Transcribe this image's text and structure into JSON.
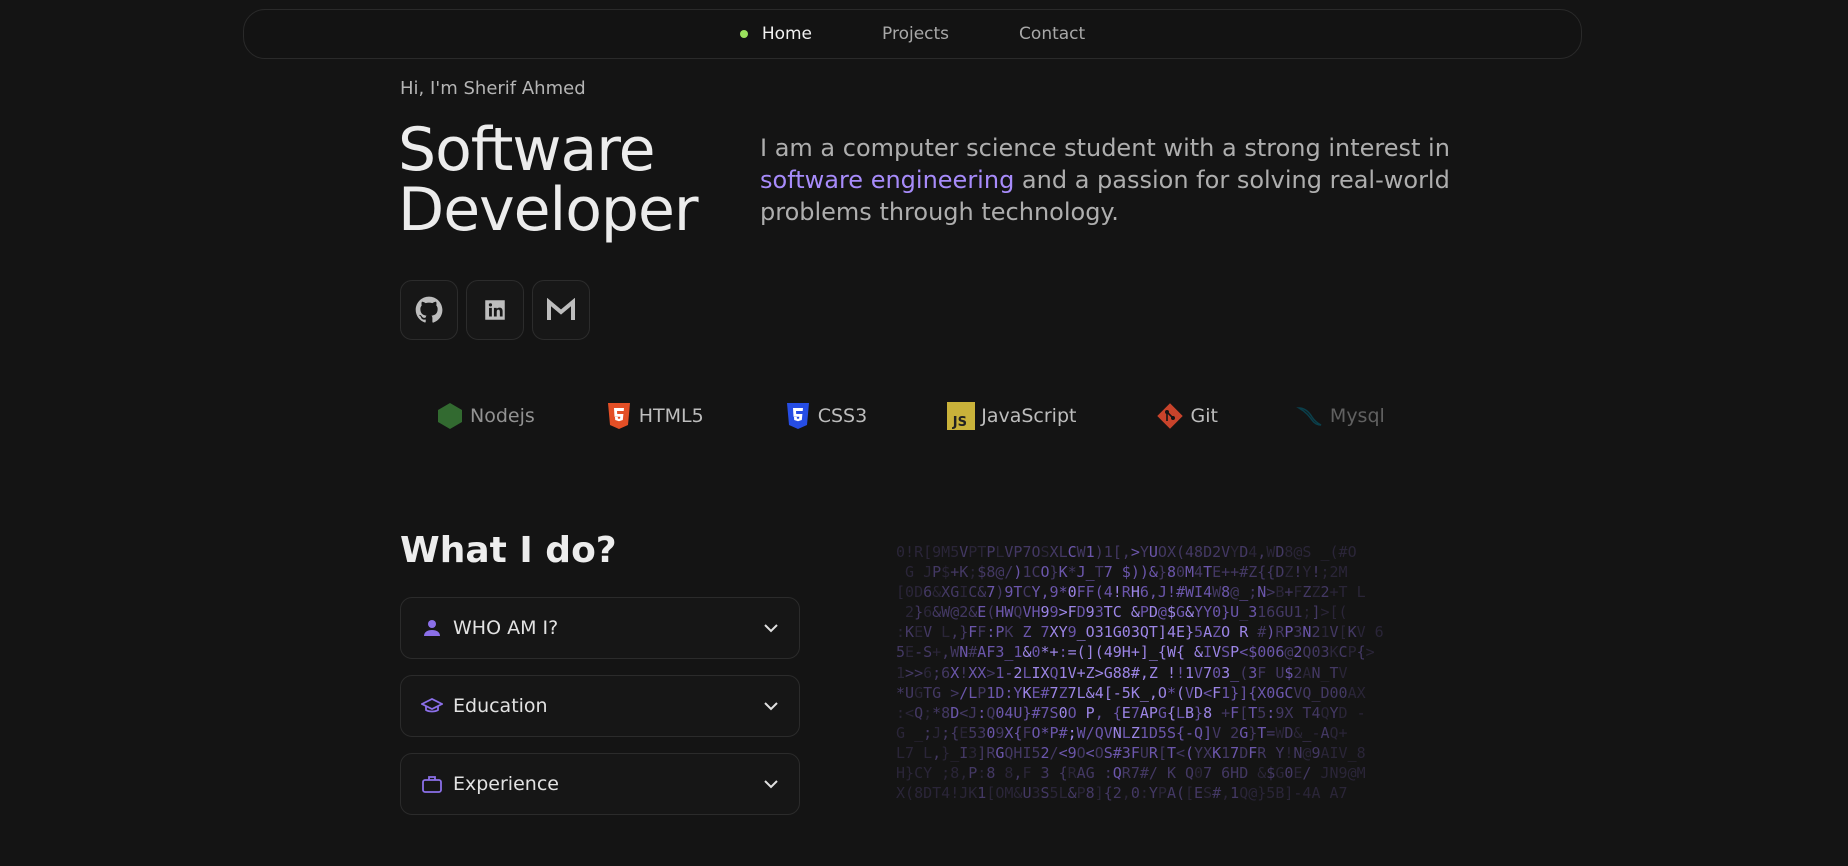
{
  "nav": {
    "items": [
      {
        "label": "Home",
        "active": true
      },
      {
        "label": "Projects",
        "active": false
      },
      {
        "label": "Contact",
        "active": false
      }
    ],
    "active_dot_color": "#9be15d"
  },
  "hero": {
    "greeting": "Hi, I'm Sherif Ahmed",
    "title_line1": "Software",
    "title_line2": "Developer",
    "bio_before": "I am a computer science student with a strong interest in ",
    "bio_highlight": "software engineering",
    "bio_after": " and a passion for solving real-world problems through technology.",
    "highlight_color": "#a78bfa"
  },
  "socials": [
    {
      "name": "github-icon"
    },
    {
      "name": "linkedin-icon"
    },
    {
      "name": "gmail-icon"
    }
  ],
  "skills": [
    {
      "label": "Nodejs",
      "icon": "nodejs-icon",
      "color": "#3c873a"
    },
    {
      "label": "HTML5",
      "icon": "html5-icon",
      "color": "#e34f26"
    },
    {
      "label": "CSS3",
      "icon": "css3-icon",
      "color": "#264de4"
    },
    {
      "label": "JavaScript",
      "icon": "javascript-icon",
      "color": "#f0db4f"
    },
    {
      "label": "Git",
      "icon": "git-icon",
      "color": "#f05032"
    },
    {
      "label": "Mysql",
      "icon": "mysql-icon",
      "color": "#00758f"
    }
  ],
  "what_i_do": {
    "title": "What I do?",
    "accordions": [
      {
        "label": "WHO AM I?",
        "icon": "user-icon"
      },
      {
        "label": "Education",
        "icon": "graduation-cap-icon"
      },
      {
        "label": "Experience",
        "icon": "briefcase-icon"
      }
    ],
    "accent_color": "#8b6fe8"
  },
  "matrix_lines": [
    "0!R[9M5VPTPLVP7OSXLCW1)1[,>YUOX(48D2VYD4,WD8@S _(#O",
    " G JP$+K;$8@/)1CO}K*J_T7 $))&}80M4TE++#Z{{DZ!Y!;2M ",
    "[0D6&XGIC&7)9TCY,9*0FF(4!RH6,J!#WI4W8@_;N>B+FZZ2+T L",
    " 2}6&W@2&E(HWQVH99>FD93TC &PD@$G&YY0}U_316GU1;]>[(",
    ":KEV L,}FF:PK Z 7XY9_O31G03QT]4E}5AZO R #)RP3N21V[KV 6",
    "5E-S+,WN#AF3_1&0*+:=(](49H+]_{W{ &IVSP<$006@2Q03KCP{>",
    "1>>6;6X!XX>1-2LIXQ1V+Z>G88#,Z !!1V703_(3F U$2AN_TV",
    "*UGTG >/LP1D:YKE#7Z7L&4[-5K_,O*(VD<F1}]{X0GCVQ_D00AX ",
    ":<Q;*8D<J:Q04U}#7S0O P, {E7APG{LB}8 +F[T5:9X T4QYD -",
    "G _;J;{E5309X{FO*P#;W/QVNLZ1D5S{-Q]V 2G}T=WD&_-AQ+",
    "L7 L,}_I3]RGQHI52/<9O<OS#3FUR[T<(YXK17DFR Y!N@9AIV_8",
    "H}CY ;8,P:8 8,F 3 {RAG :QR7#/ K Q07 6HD &$G0E/ JN9@M ",
    "X(8DT4!JK1[OM&U3S5L&P8]{2,0:YPA([ES#,1Q@}5B]-4A A7 "
  ]
}
